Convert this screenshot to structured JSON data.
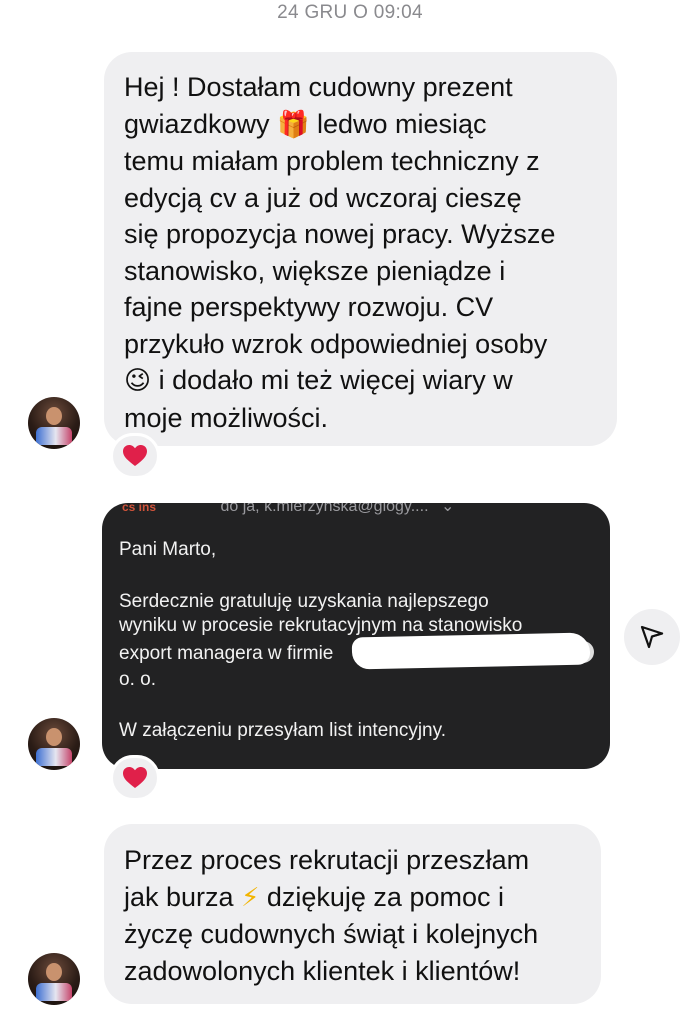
{
  "header": {
    "timestamp": "24 GRU O 09:04"
  },
  "messages": {
    "first": {
      "lines": [
        "Hej ! Dostałam cudowny prezent",
        "gwiazdkowy",
        "ledwo miesiąc",
        "temu miałam problem techniczny z",
        "edycją cv a już od wczoraj cieszę",
        "się propozycja nowej pracy. Wyższe",
        "stanowisko, większe pieniądze i",
        "fajne perspektywy rozwoju. CV",
        "przykuło wzrok odpowiedniej osoby",
        "i dodało mi też więcej wiary w",
        "moje możliwości."
      ],
      "emoji_gift": "🎁",
      "emoji_wink": "😉",
      "reaction": "❤"
    },
    "email": {
      "header_sender": "cs ins",
      "header_recipients": "do ja, k.mierzynska@glogy....",
      "header_chevron": "⌄",
      "greeting": "Pani Marto,",
      "body_lines": [
        "Serdecznie gratuluję uzyskania najlepszego",
        "wyniku w procesie rekrutacyjnym na stanowisko",
        "export managera w firmie",
        "o. o."
      ],
      "attachment_line": "W załączeniu przesyłam list intencyjny.",
      "reaction": "❤"
    },
    "third": {
      "lines": [
        "Przez proces rekrutacji przeszłam",
        "jak burza",
        "dziękuję za pomoc i",
        "życzę cudownych świąt i kolejnych",
        "zadowolonych klientek i klientów!"
      ],
      "emoji_bolt": "⚡"
    }
  },
  "icons": {
    "share": "share-icon",
    "reaction_heart": "heart-icon",
    "avatar": "avatar-photo"
  },
  "colors": {
    "bubble": "#efeff1",
    "email_card": "#222223",
    "timestamp": "#8a8a8e",
    "heart": "#e0204a"
  }
}
